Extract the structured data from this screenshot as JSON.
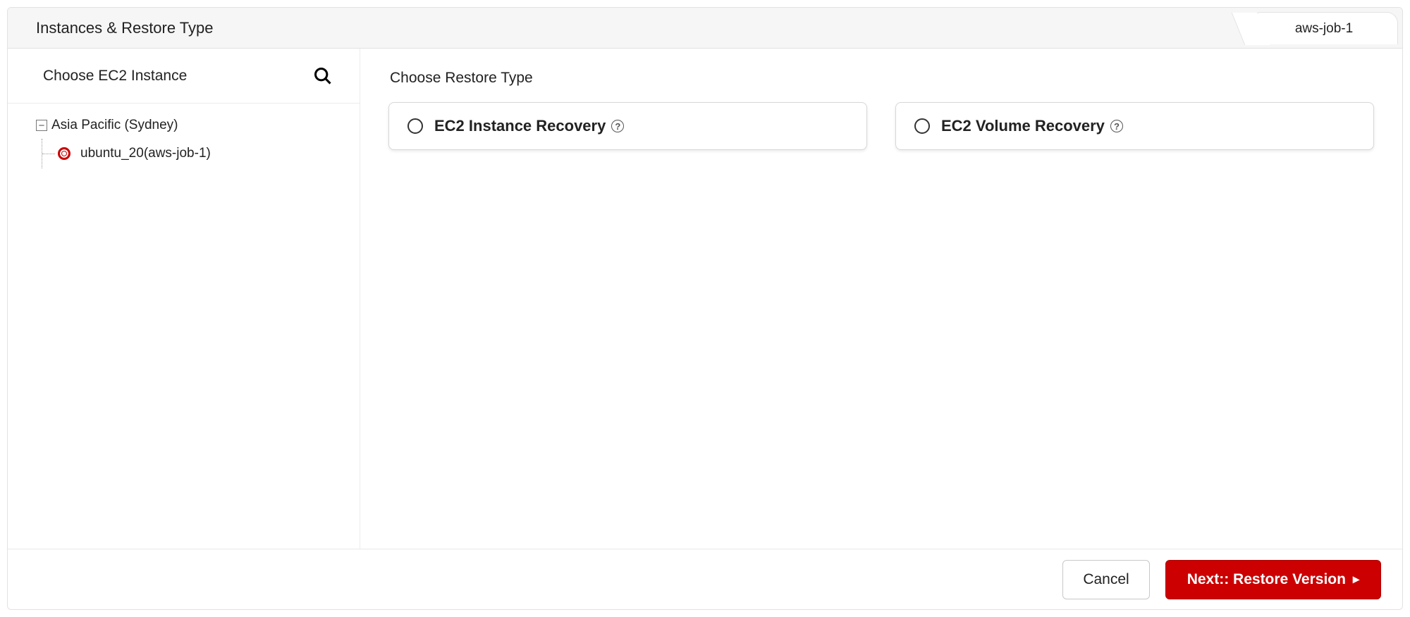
{
  "header": {
    "title": "Instances & Restore Type",
    "job_tab": "aws-job-1"
  },
  "left": {
    "title": "Choose EC2 Instance",
    "search_icon": "search-icon",
    "tree": {
      "region_label": "Asia Pacific (Sydney)",
      "expander_symbol": "−",
      "instance_label": "ubuntu_20(aws-job-1)"
    }
  },
  "right": {
    "title": "Choose Restore Type",
    "options": [
      {
        "label": "EC2 Instance Recovery",
        "help": "?"
      },
      {
        "label": "EC2 Volume Recovery",
        "help": "?"
      }
    ]
  },
  "footer": {
    "cancel": "Cancel",
    "next": "Next:: Restore Version",
    "next_chevron": "▸"
  }
}
